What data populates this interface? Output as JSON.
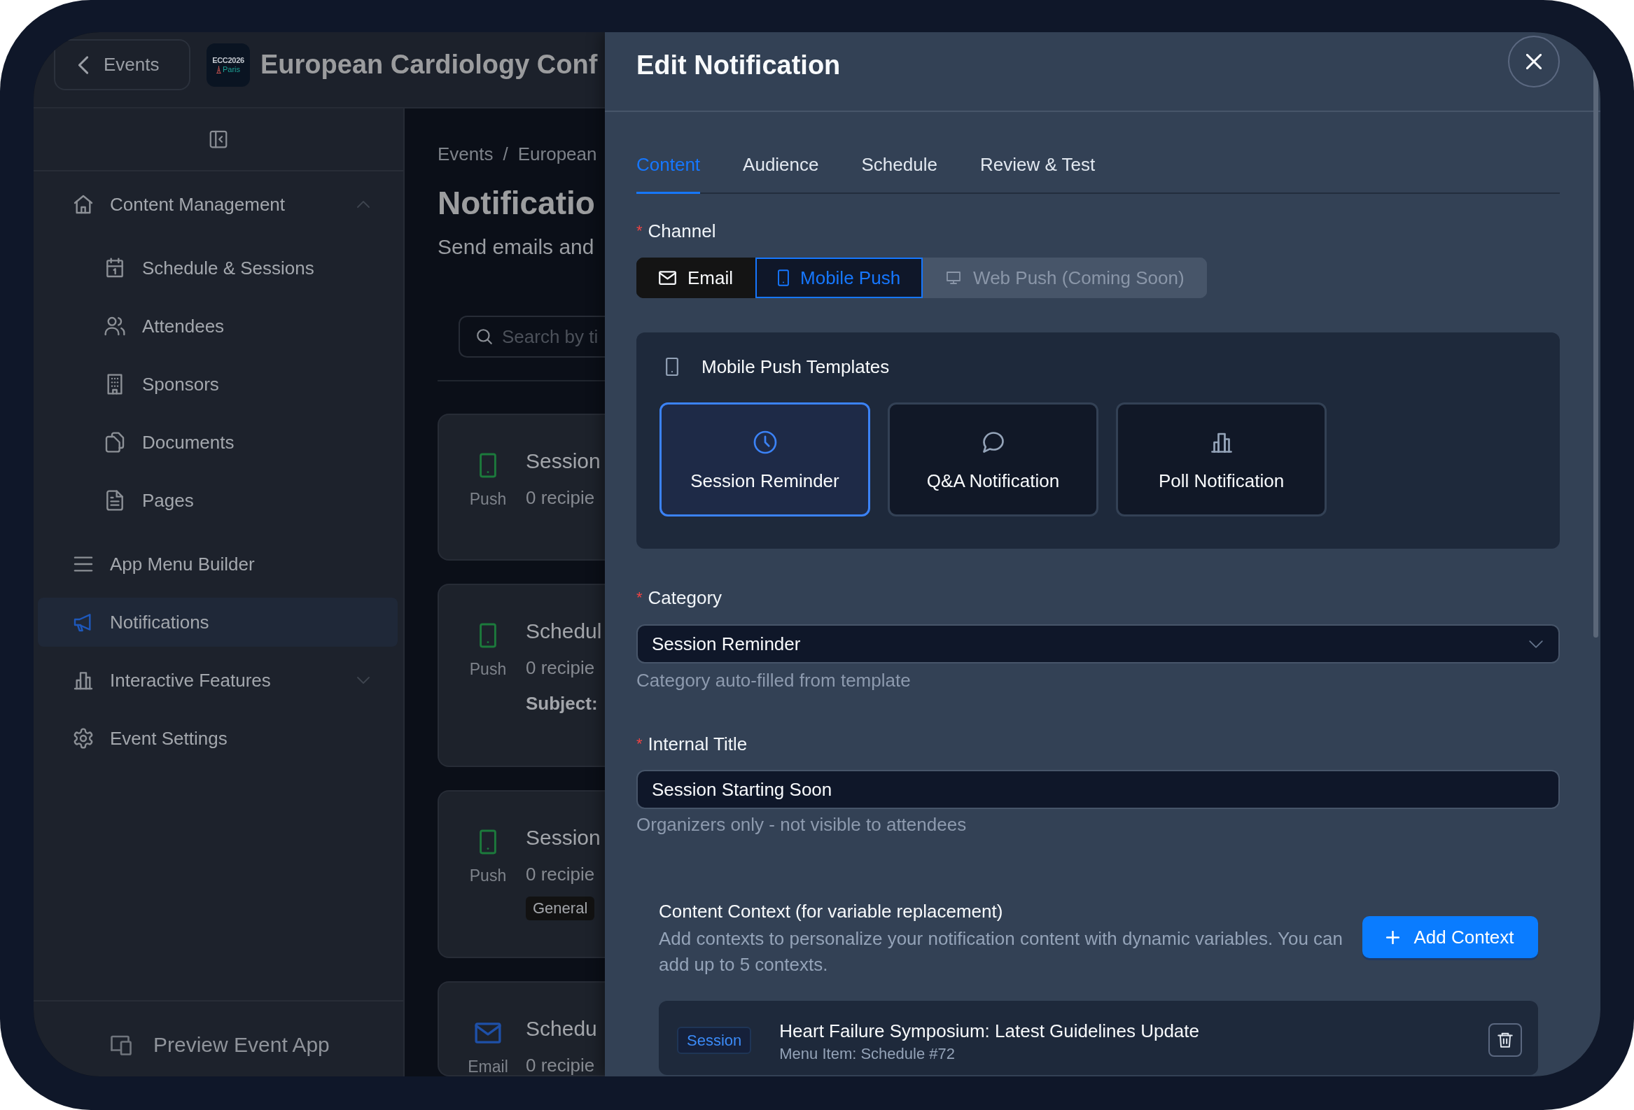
{
  "header": {
    "back_button": "Events",
    "logo": {
      "line_1": "ECC2026",
      "line_2": "Paris"
    },
    "event_title": "European Cardiology Conf"
  },
  "sidebar": {
    "items": [
      {
        "label": "Content Management",
        "selected": false,
        "expanded": true,
        "children": [
          {
            "label": "Schedule & Sessions",
            "selected": false
          },
          {
            "label": "Attendees",
            "selected": false
          },
          {
            "label": "Sponsors",
            "selected": false
          },
          {
            "label": "Documents",
            "selected": false
          },
          {
            "label": "Pages",
            "selected": false
          }
        ]
      },
      {
        "label": "App Menu Builder",
        "selected": false
      },
      {
        "label": "Notifications",
        "selected": true
      },
      {
        "label": "Interactive Features",
        "selected": false,
        "expanded": false
      },
      {
        "label": "Event Settings",
        "selected": false
      }
    ],
    "footer_button": "Preview Event App"
  },
  "page": {
    "breadcrumb": {
      "items": [
        "Events",
        "European"
      ],
      "separator": "/"
    },
    "title": "Notificatio",
    "subtitle": "Send emails and",
    "search": {
      "placeholder": "Search by ti"
    },
    "cards": [
      {
        "kind": "push",
        "channel": "Push",
        "title": "Session",
        "recipients": "0 recipie"
      },
      {
        "kind": "push",
        "channel": "Push",
        "title": "Schedul",
        "recipients": "0 recipie",
        "subject_label": "Subject:"
      },
      {
        "kind": "push",
        "channel": "Push",
        "title": "Session",
        "recipients": "0 recipie",
        "tag": "General"
      },
      {
        "kind": "email",
        "channel": "Email",
        "title": "Schedu",
        "recipients": "0 recipie"
      }
    ]
  },
  "drawer": {
    "title": "Edit Notification",
    "tabs": [
      {
        "label": "Content",
        "selected": true
      },
      {
        "label": "Audience",
        "selected": false
      },
      {
        "label": "Schedule",
        "selected": false
      },
      {
        "label": "Review & Test",
        "selected": false
      }
    ],
    "channel": {
      "label": "Channel",
      "required_mark": "*",
      "options": [
        {
          "label": "Email",
          "selected": false,
          "disabled": false
        },
        {
          "label": "Mobile Push",
          "selected": true,
          "disabled": false
        },
        {
          "label": "Web Push (Coming Soon)",
          "selected": false,
          "disabled": true
        }
      ]
    },
    "templates": {
      "title": "Mobile Push Templates",
      "items": [
        {
          "label": "Session Reminder",
          "selected": true
        },
        {
          "label": "Q&A Notification",
          "selected": false
        },
        {
          "label": "Poll Notification",
          "selected": false
        }
      ]
    },
    "category": {
      "label": "Category",
      "required_mark": "*",
      "value": "Session Reminder",
      "help": "Category auto-filled from template"
    },
    "internal_title": {
      "label": "Internal Title",
      "required_mark": "*",
      "value": "Session Starting Soon",
      "help": "Organizers only - not visible to attendees"
    },
    "content_context": {
      "title": "Content Context (for variable replacement)",
      "description": "Add contexts to personalize your notification content with dynamic variables. You can add up to 5 contexts.",
      "add_button": "Add Context",
      "items": [
        {
          "tag": "Session",
          "title": "Heart Failure Symposium: Latest Guidelines Update",
          "subtitle": "Menu Item: Schedule #72"
        }
      ]
    }
  }
}
